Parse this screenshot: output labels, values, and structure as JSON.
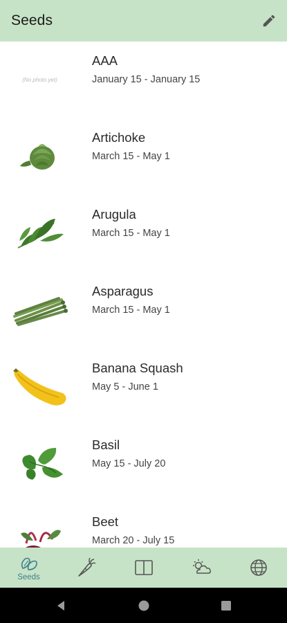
{
  "app_bar": {
    "title": "Seeds",
    "edit_icon": "pencil-icon"
  },
  "seeds": [
    {
      "name": "AAA",
      "dates": "January 15 - January 15",
      "photo": "(No photo yet)"
    },
    {
      "name": "Artichoke",
      "dates": "March 15 - May 1",
      "photo": "artichoke"
    },
    {
      "name": "Arugula",
      "dates": "March 15 - May 1",
      "photo": "arugula"
    },
    {
      "name": "Asparagus",
      "dates": "March 15 - May 1",
      "photo": "asparagus"
    },
    {
      "name": "Banana Squash",
      "dates": "May 5 - June 1",
      "photo": "banana-squash"
    },
    {
      "name": "Basil",
      "dates": "May 15 - July 20",
      "photo": "basil"
    },
    {
      "name": "Beet",
      "dates": "March 20 - July 15",
      "photo": "beet"
    }
  ],
  "bottom_nav": {
    "active": "seeds",
    "items": [
      {
        "id": "seeds",
        "label": "Seeds",
        "icon": "seeds-icon"
      },
      {
        "id": "plants",
        "label": "",
        "icon": "carrot-icon"
      },
      {
        "id": "journal",
        "label": "",
        "icon": "book-icon"
      },
      {
        "id": "weather",
        "label": "",
        "icon": "weather-icon"
      },
      {
        "id": "web",
        "label": "",
        "icon": "globe-icon"
      }
    ]
  },
  "colors": {
    "bar": "#c7e3c7",
    "accent": "#3f7f8f",
    "text": "#2a2a2a"
  }
}
